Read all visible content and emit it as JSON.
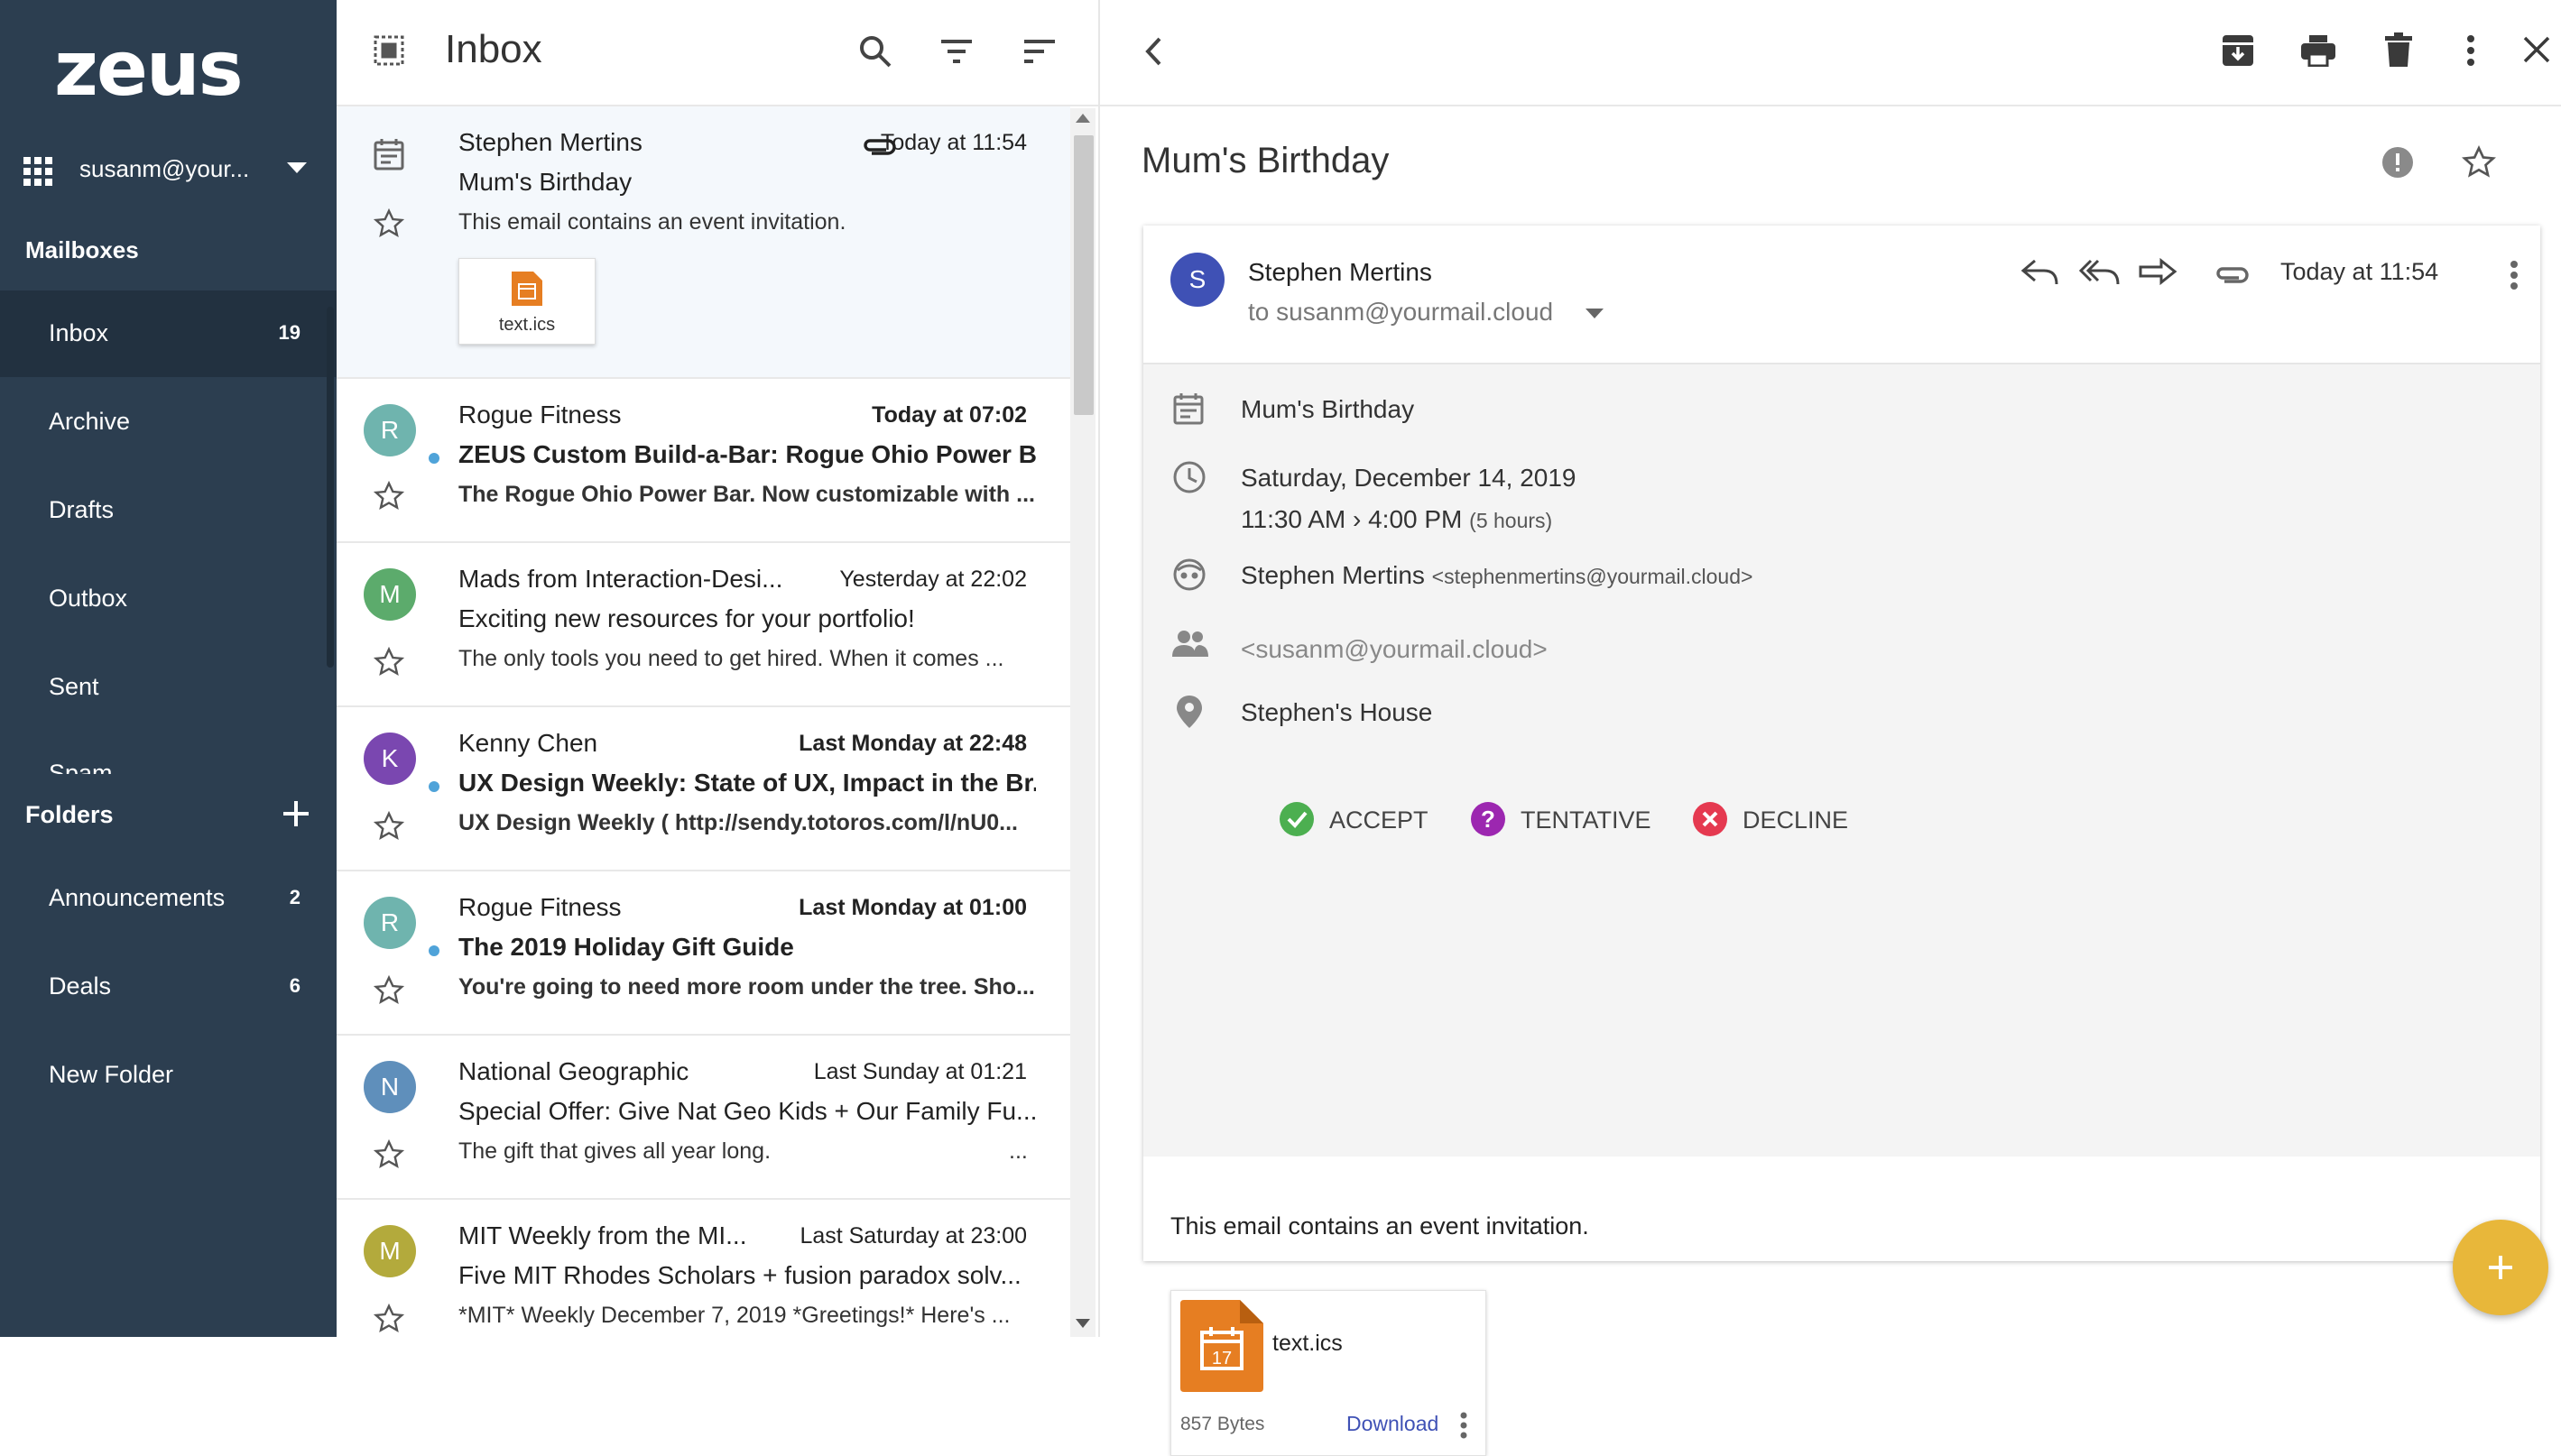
{
  "brand": {
    "logo_text": "zeus"
  },
  "account": {
    "label": "susanm@your..."
  },
  "sidebar": {
    "mailboxes_title": "Mailboxes",
    "mailboxes": [
      {
        "label": "Inbox",
        "count": "19"
      },
      {
        "label": "Archive",
        "count": ""
      },
      {
        "label": "Drafts",
        "count": ""
      },
      {
        "label": "Outbox",
        "count": ""
      },
      {
        "label": "Sent",
        "count": ""
      },
      {
        "label": "Spam",
        "count": ""
      }
    ],
    "folders_title": "Folders",
    "folders": [
      {
        "label": "Announcements",
        "count": "2"
      },
      {
        "label": "Deals",
        "count": "6"
      },
      {
        "label": "New Folder",
        "count": ""
      }
    ]
  },
  "list": {
    "title": "Inbox",
    "messages": [
      {
        "from": "Stephen Mertins",
        "time": "Today at 11:54",
        "subject": "Mum's Birthday",
        "snippet": "This email contains an event invitation.",
        "attachment": "text.ics",
        "avatar": ""
      },
      {
        "from": "Rogue Fitness",
        "time": "Today at 07:02",
        "subject": "ZEUS Custom Build-a-Bar: Rogue Ohio Power Bar",
        "snippet": "The Rogue Ohio Power Bar. Now customizable with ...",
        "avatar": "R"
      },
      {
        "from": "Mads from Interaction-Desi...",
        "time": "Yesterday at 22:02",
        "subject": "Exciting new resources for your portfolio!",
        "snippet": "The only tools you need to get hired. When it comes ...",
        "avatar": "M"
      },
      {
        "from": "Kenny Chen",
        "time": "Last Monday at 22:48",
        "subject": "UX Design Weekly: State of UX, Impact in the Br...",
        "snippet": "UX Design Weekly ( http://sendy.totoros.com/l/nU0...",
        "avatar": "K"
      },
      {
        "from": "Rogue Fitness",
        "time": "Last Monday at 01:00",
        "subject": "The 2019 Holiday Gift Guide",
        "snippet": "You're going to need more room under the tree. Sho...",
        "avatar": "R"
      },
      {
        "from": "National Geographic",
        "time": "Last Sunday at 01:21",
        "subject": "Special Offer: Give Nat Geo Kids + Our Family Fu...",
        "snippet": "The gift that gives all year long.",
        "snippet_tail": "...",
        "avatar": "N"
      },
      {
        "from": "MIT Weekly from the MI...",
        "time": "Last Saturday at 23:00",
        "subject": "Five MIT Rhodes Scholars + fusion paradox solv...",
        "snippet": "*MIT* Weekly December 7, 2019 *Greetings!* Here's ...",
        "avatar": "M"
      }
    ]
  },
  "reader": {
    "subject": "Mum's Birthday",
    "sender_initial": "S",
    "sender_name": "Stephen Mertins",
    "to_line": "to susanm@yourmail.cloud",
    "time": "Today at 11:54",
    "event": {
      "title": "Mum's Birthday",
      "date": "Saturday, December 14, 2019",
      "time_range": "11:30 AM › 4:00 PM",
      "duration": "(5 hours)",
      "organizer": "Stephen Mertins",
      "organizer_email": "<stephenmertins@yourmail.cloud>",
      "attendee_email": "<susanm@yourmail.cloud>",
      "location": "Stephen's House",
      "accept": "ACCEPT",
      "tentative": "TENTATIVE",
      "decline": "DECLINE"
    },
    "body": "This email contains an event invitation.",
    "attachment": {
      "name": "text.ics",
      "size": "857 Bytes",
      "download": "Download",
      "icon_day": "17"
    }
  },
  "colors": {
    "sidebar_bg": "#2c3e50",
    "sidebar_active": "#223140",
    "accept": "#4caf50",
    "tentative": "#9c27b0",
    "decline": "#e53950",
    "fab": "#e8b73a",
    "link": "#3f51b5",
    "unread_dot": "#4fa3d9",
    "ics_orange": "#e67e22"
  },
  "icons": [
    "apps-grid-icon",
    "caret-down-icon",
    "add-icon",
    "select-all-icon",
    "search-icon",
    "filter-icon",
    "sort-icon",
    "calendar-icon",
    "star-icon",
    "paperclip-icon",
    "back-icon",
    "archive-icon",
    "print-icon",
    "trash-icon",
    "more-vert-icon",
    "close-icon",
    "report-icon",
    "reply-icon",
    "reply-all-icon",
    "forward-icon",
    "clock-icon",
    "person-icon",
    "people-icon",
    "location-icon",
    "check-circle-icon",
    "help-circle-icon",
    "cancel-circle-icon",
    "ics-file-icon"
  ]
}
